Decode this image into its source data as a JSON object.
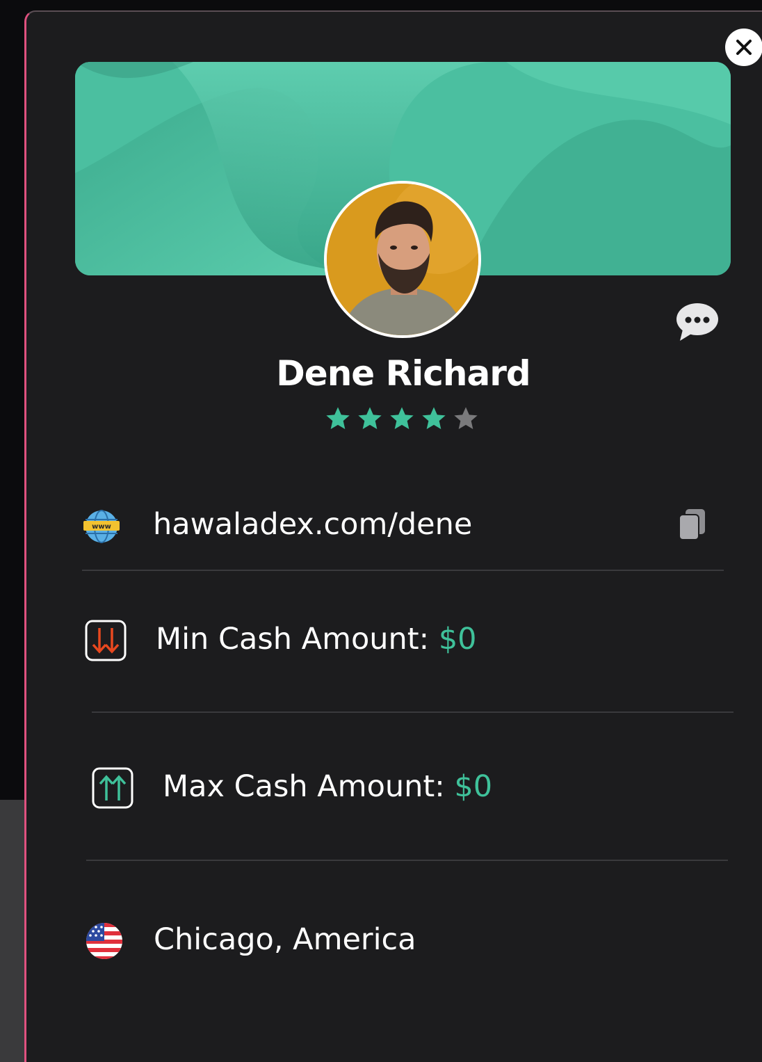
{
  "profile": {
    "name": "Dene Richard",
    "rating": 4,
    "rating_max": 5,
    "star_on_color": "#3fc19a",
    "star_off_color": "#7a7a7c"
  },
  "details": {
    "website": "hawaladex.com/dene",
    "min_label": "Min Cash Amount:",
    "min_value": "$0",
    "max_label": "Max Cash Amount:",
    "max_value": "$0",
    "location": "Chicago, America"
  },
  "colors": {
    "accent": "#3fc19a",
    "card_bg": "#1c1c1e",
    "banner": "#4bbfa0"
  },
  "icons": {
    "close": "close-icon",
    "chat": "chat-bubble-icon",
    "website": "www-globe-icon",
    "copy": "copy-icon",
    "min": "arrows-down-icon",
    "max": "arrows-up-icon",
    "location": "us-flag-icon"
  }
}
